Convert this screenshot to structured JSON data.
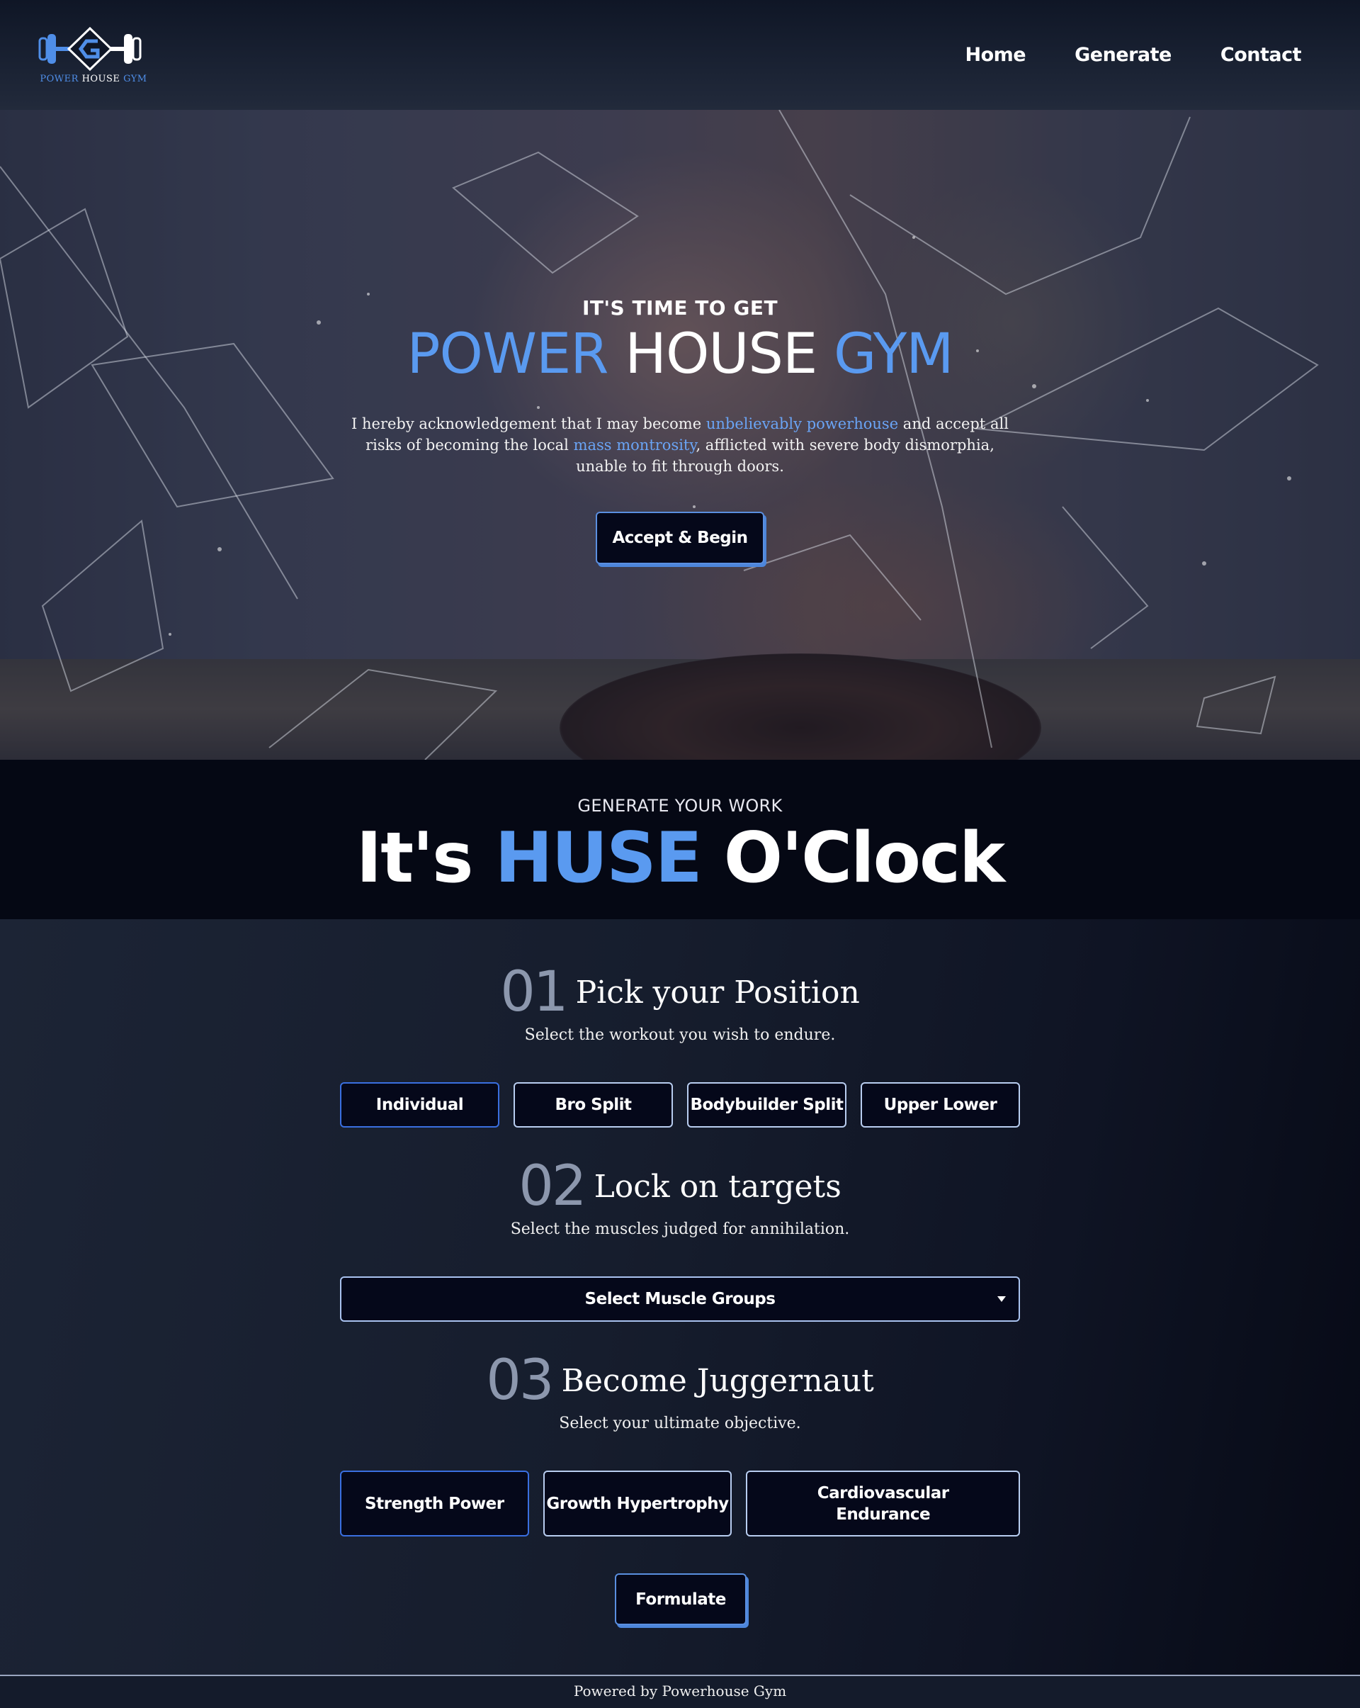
{
  "header": {
    "logo_text_1": "POWER",
    "logo_text_2": "HOUSE",
    "logo_text_3": "GYM",
    "nav": [
      "Home",
      "Generate",
      "Contact"
    ]
  },
  "hero": {
    "kicker": "IT'S TIME TO GET",
    "title_1": "POWER",
    "title_2": "HOUSE",
    "title_3": "GYM",
    "desc_1": "I hereby acknowledgement that I may become ",
    "desc_hl_1": "unbelievably powerhouse",
    "desc_2": " and accept all risks of becoming the local ",
    "desc_hl_2": "mass montrosity",
    "desc_3": ", afflicted with severe body dismorphia, unable to fit through doors.",
    "button": "Accept & Begin"
  },
  "generate": {
    "kicker": "GENERATE YOUR WORK",
    "title_1": "It's",
    "title_2": "HUSE",
    "title_3": "O'Clock"
  },
  "steps": [
    {
      "num": "01",
      "title": "Pick your Position",
      "sub": "Select the workout you wish to endure.",
      "options": [
        "Individual",
        "Bro Split",
        "Bodybuilder Split",
        "Upper Lower"
      ]
    },
    {
      "num": "02",
      "title": "Lock on targets",
      "sub": "Select the muscles judged for annihilation.",
      "select_label": "Select Muscle Groups"
    },
    {
      "num": "03",
      "title": "Become Juggernaut",
      "sub": "Select your ultimate objective.",
      "options": [
        "Strength Power",
        "Growth Hypertrophy",
        "Cardiovascular Endurance"
      ]
    }
  ],
  "formulate": "Formulate",
  "footer": "Powered by Powerhouse Gym",
  "colors": {
    "accent": "#5a9af0",
    "button_bg": "#05081a",
    "page_bg": "#161d2d"
  }
}
